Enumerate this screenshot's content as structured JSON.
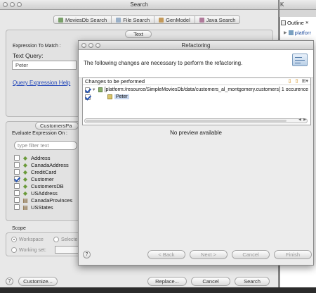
{
  "main_window": {
    "title": "Search",
    "tabs": [
      {
        "label": "MoviesDb Search"
      },
      {
        "label": "File Search"
      },
      {
        "label": "GenModel"
      },
      {
        "label": "Java Search"
      }
    ],
    "text_group_label": "Text",
    "expression_to_match": "Expression To Match :",
    "text_query_label": "Text Query:",
    "text_query_value": "Peter",
    "query_help_link": "Query Expression Help",
    "customers_group_label": "CustomersPa",
    "evaluate_on_label": "Evaluate Expression On :",
    "filter_placeholder": "type filter text",
    "types": [
      {
        "name": "Address",
        "checked": false,
        "kind": "class"
      },
      {
        "name": "CanadaAddress",
        "checked": false,
        "kind": "class"
      },
      {
        "name": "CreditCard",
        "checked": false,
        "kind": "class"
      },
      {
        "name": "Customer",
        "checked": true,
        "kind": "class"
      },
      {
        "name": "CustomersDB",
        "checked": false,
        "kind": "class"
      },
      {
        "name": "USAddress",
        "checked": false,
        "kind": "class"
      },
      {
        "name": "CanadaProvinces",
        "checked": false,
        "kind": "enum"
      },
      {
        "name": "USStates",
        "checked": false,
        "kind": "enum"
      }
    ],
    "scope_label": "Scope",
    "scope_workspace": "Workspace",
    "scope_selected": "Selecte",
    "working_set_label": "Working set:",
    "customize_button": "Customize...",
    "replace_button": "Replace...",
    "cancel_button": "Cancel",
    "search_button": "Search"
  },
  "outline": {
    "title": "Outline",
    "item": "platforr",
    "edge_letter": "K"
  },
  "refactoring": {
    "title": "Refactoring",
    "message": "The following changes are necessary to perform the refactoring.",
    "changes_label": "Changes to be performed",
    "change_row": "[platform:/resource/SimpleMoviesDb/data/customers_al_montgomery.customers] 1 occurence",
    "child_row": "Peter",
    "no_preview": "No preview available",
    "back_button": "< Back",
    "next_button": "Next >",
    "cancel_button": "Cancel",
    "finish_button": "Finish"
  },
  "colors": {
    "link": "#2145b8",
    "selection_highlight": "#c7d7f0"
  }
}
